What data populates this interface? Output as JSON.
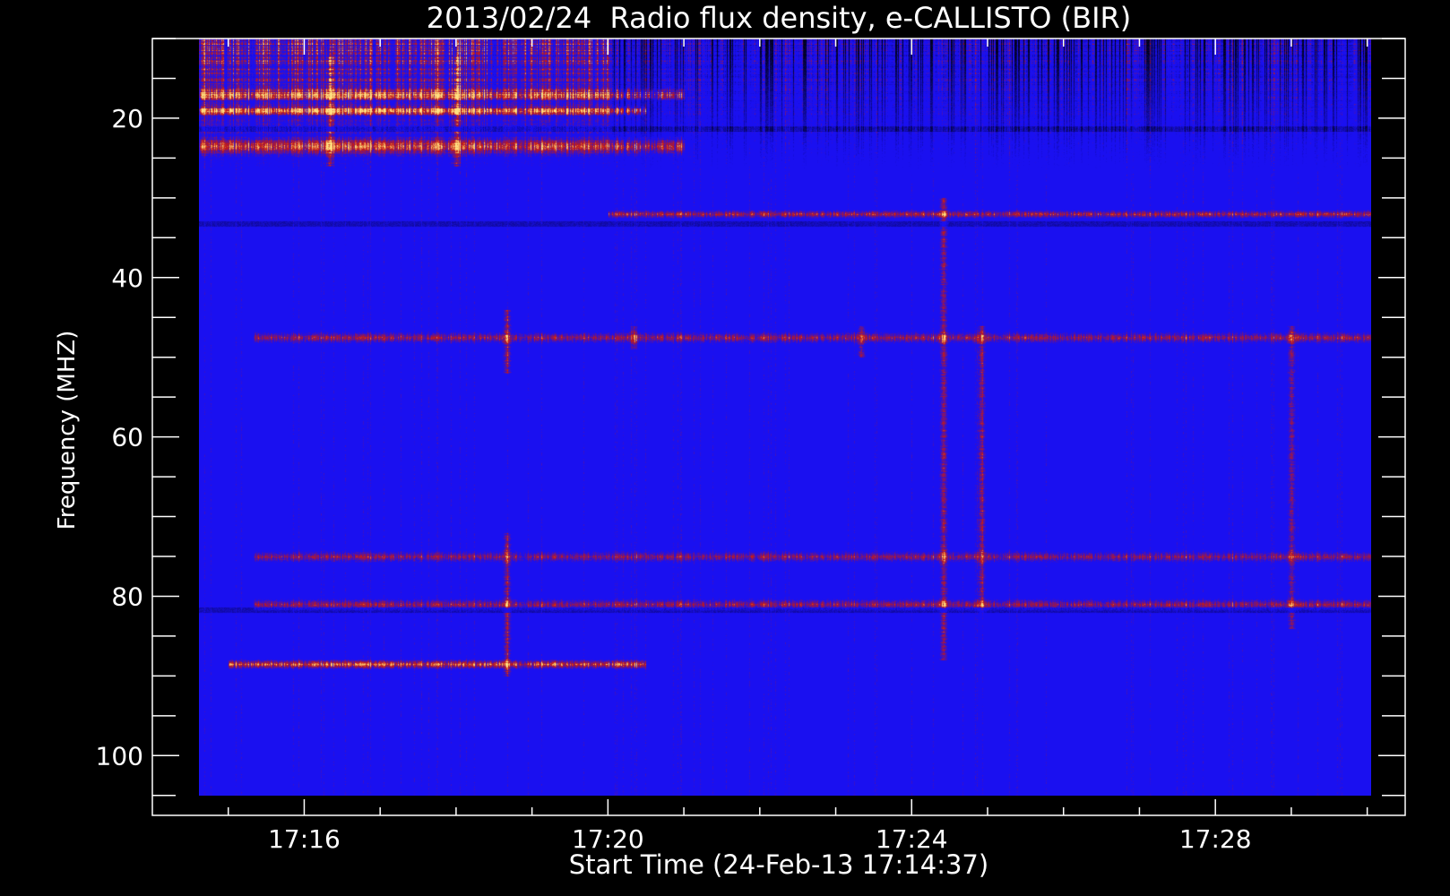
{
  "chart_data": {
    "type": "heatmap",
    "title": "2013/02/24  Radio flux density, e-CALLISTO (BIR)",
    "xlabel": "Start Time (24-Feb-13 17:14:37)",
    "ylabel": "Frequency (MHZ)",
    "x_range": [
      "17:14:37",
      "17:30:03"
    ],
    "xlim": [
      "17:14:00",
      "17:30:30"
    ],
    "y_range": [
      10,
      105
    ],
    "ylim": [
      10,
      107.5
    ],
    "y_inverted": true,
    "x_ticks": [
      "17:16",
      "17:20",
      "17:24",
      "17:28"
    ],
    "y_ticks": [
      20,
      40,
      60,
      80,
      100
    ],
    "grid": false,
    "colors": {
      "background": "#000000",
      "axes": "#ffffff",
      "low": "#1a10f0",
      "mid": "#c81a10",
      "high": "#ffe080",
      "dropout": "#000018"
    },
    "bursts": [
      {
        "time": "17:16:20",
        "freq_range": [
          12,
          26
        ],
        "intensity": 0.9
      },
      {
        "time": "17:18:00",
        "freq_range": [
          12,
          26
        ],
        "intensity": 0.85
      },
      {
        "time": "17:18:40",
        "freq_range": [
          44,
          52
        ],
        "intensity": 0.95
      },
      {
        "time": "17:18:40",
        "freq_range": [
          72,
          90
        ],
        "intensity": 0.95
      },
      {
        "time": "17:20:20",
        "freq_range": [
          46,
          49
        ],
        "intensity": 0.7
      },
      {
        "time": "17:23:20",
        "freq_range": [
          46,
          50
        ],
        "intensity": 0.85
      },
      {
        "time": "17:24:25",
        "freq_range": [
          30,
          88
        ],
        "intensity": 1.0
      },
      {
        "time": "17:24:55",
        "freq_range": [
          46,
          82
        ],
        "intensity": 0.9
      },
      {
        "time": "17:29:00",
        "freq_range": [
          46,
          84
        ],
        "intensity": 0.85
      }
    ],
    "bands": [
      {
        "freq": 17,
        "freq_width": 1.5,
        "time_range": [
          "17:14:37",
          "17:21:00"
        ],
        "intensity": 0.9
      },
      {
        "freq": 19,
        "freq_width": 1.2,
        "time_range": [
          "17:14:37",
          "17:20:30"
        ],
        "intensity": 0.95
      },
      {
        "freq": 23.5,
        "freq_width": 2.5,
        "time_range": [
          "17:14:37",
          "17:21:00"
        ],
        "intensity": 0.85
      },
      {
        "freq": 32,
        "freq_width": 1.0,
        "time_range": [
          "17:20:00",
          "17:30:03"
        ],
        "intensity": 0.75
      },
      {
        "freq": 47.5,
        "freq_width": 1.5,
        "time_range": [
          "17:15:20",
          "17:30:03"
        ],
        "intensity": 0.65
      },
      {
        "freq": 75,
        "freq_width": 1.5,
        "time_range": [
          "17:15:20",
          "17:30:03"
        ],
        "intensity": 0.6
      },
      {
        "freq": 81,
        "freq_width": 1.5,
        "time_range": [
          "17:15:20",
          "17:30:03"
        ],
        "intensity": 0.65
      },
      {
        "freq": 88.5,
        "freq_width": 1.2,
        "time_range": [
          "17:15:00",
          "17:20:30"
        ],
        "intensity": 0.95
      }
    ]
  }
}
